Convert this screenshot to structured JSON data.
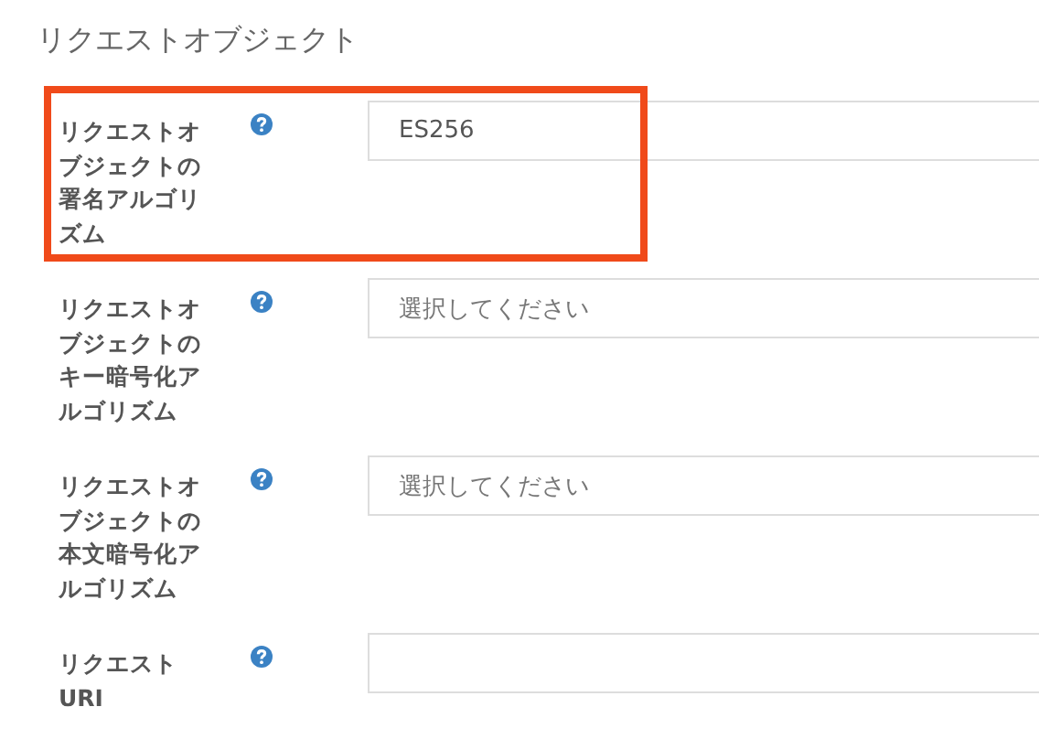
{
  "section": {
    "title": "リクエストオブジェクト"
  },
  "fields": [
    {
      "label": "リクエストオブジェクトの署名アルゴリズム",
      "kind": "text",
      "value": "ES256",
      "highlighted": true
    },
    {
      "label": "リクエストオブジェクトのキー暗号化アルゴリズム",
      "kind": "select",
      "placeholder": "選択してください",
      "highlighted": false
    },
    {
      "label": "リクエストオブジェクトの本文暗号化アルゴリズム",
      "kind": "select",
      "placeholder": "選択してください",
      "highlighted": false
    },
    {
      "label": "リクエスト URI",
      "kind": "text",
      "highlighted": false
    }
  ]
}
